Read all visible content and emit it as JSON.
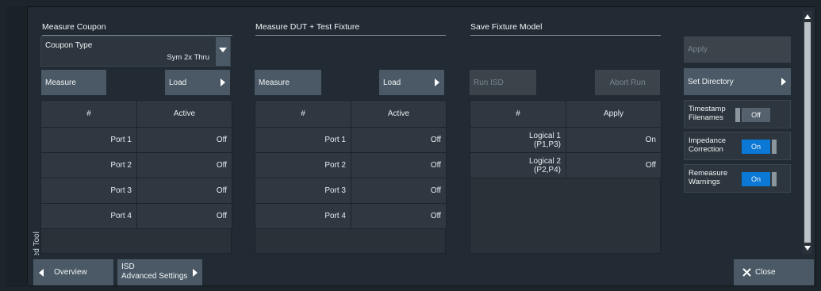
{
  "side_tab": "Balanced Tool",
  "coupon": {
    "title": "Measure Coupon",
    "combo_label": "Coupon Type",
    "combo_value": "Sym 2x Thru",
    "measure": "Measure",
    "load": "Load",
    "headers": [
      "#",
      "Active"
    ],
    "rows": [
      {
        "port": "Port 1",
        "active": "Off"
      },
      {
        "port": "Port 2",
        "active": "Off"
      },
      {
        "port": "Port 3",
        "active": "Off"
      },
      {
        "port": "Port 4",
        "active": "Off"
      }
    ]
  },
  "dut": {
    "title": "Measure DUT + Test Fixture",
    "measure": "Measure",
    "load": "Load",
    "headers": [
      "#",
      "Active"
    ],
    "rows": [
      {
        "port": "Port 1",
        "active": "Off"
      },
      {
        "port": "Port 2",
        "active": "Off"
      },
      {
        "port": "Port 3",
        "active": "Off"
      },
      {
        "port": "Port 4",
        "active": "Off"
      }
    ]
  },
  "fixture": {
    "title": "Save Fixture Model",
    "run_isd": "Run ISD",
    "abort_run": "Abort Run",
    "headers": [
      "#",
      "Apply"
    ],
    "rows": [
      {
        "l1": "Logical 1",
        "l2": "(P1,P3)",
        "apply": "On"
      },
      {
        "l1": "Logical 2",
        "l2": "(P2,P4)",
        "apply": "Off"
      }
    ]
  },
  "right": {
    "apply": "Apply",
    "set_directory": "Set Directory",
    "timestamp": {
      "l1": "Timestamp",
      "l2": "Filenames",
      "state": "Off"
    },
    "impedance": {
      "l1": "Impedance",
      "l2": "Correction",
      "state": "On"
    },
    "remeasure": {
      "l1": "Remeasure",
      "l2": "Warnings",
      "state": "On"
    }
  },
  "bottom": {
    "overview": "Overview",
    "isd_l1": "ISD",
    "isd_l2": "Advanced Settings",
    "close": "Close"
  }
}
